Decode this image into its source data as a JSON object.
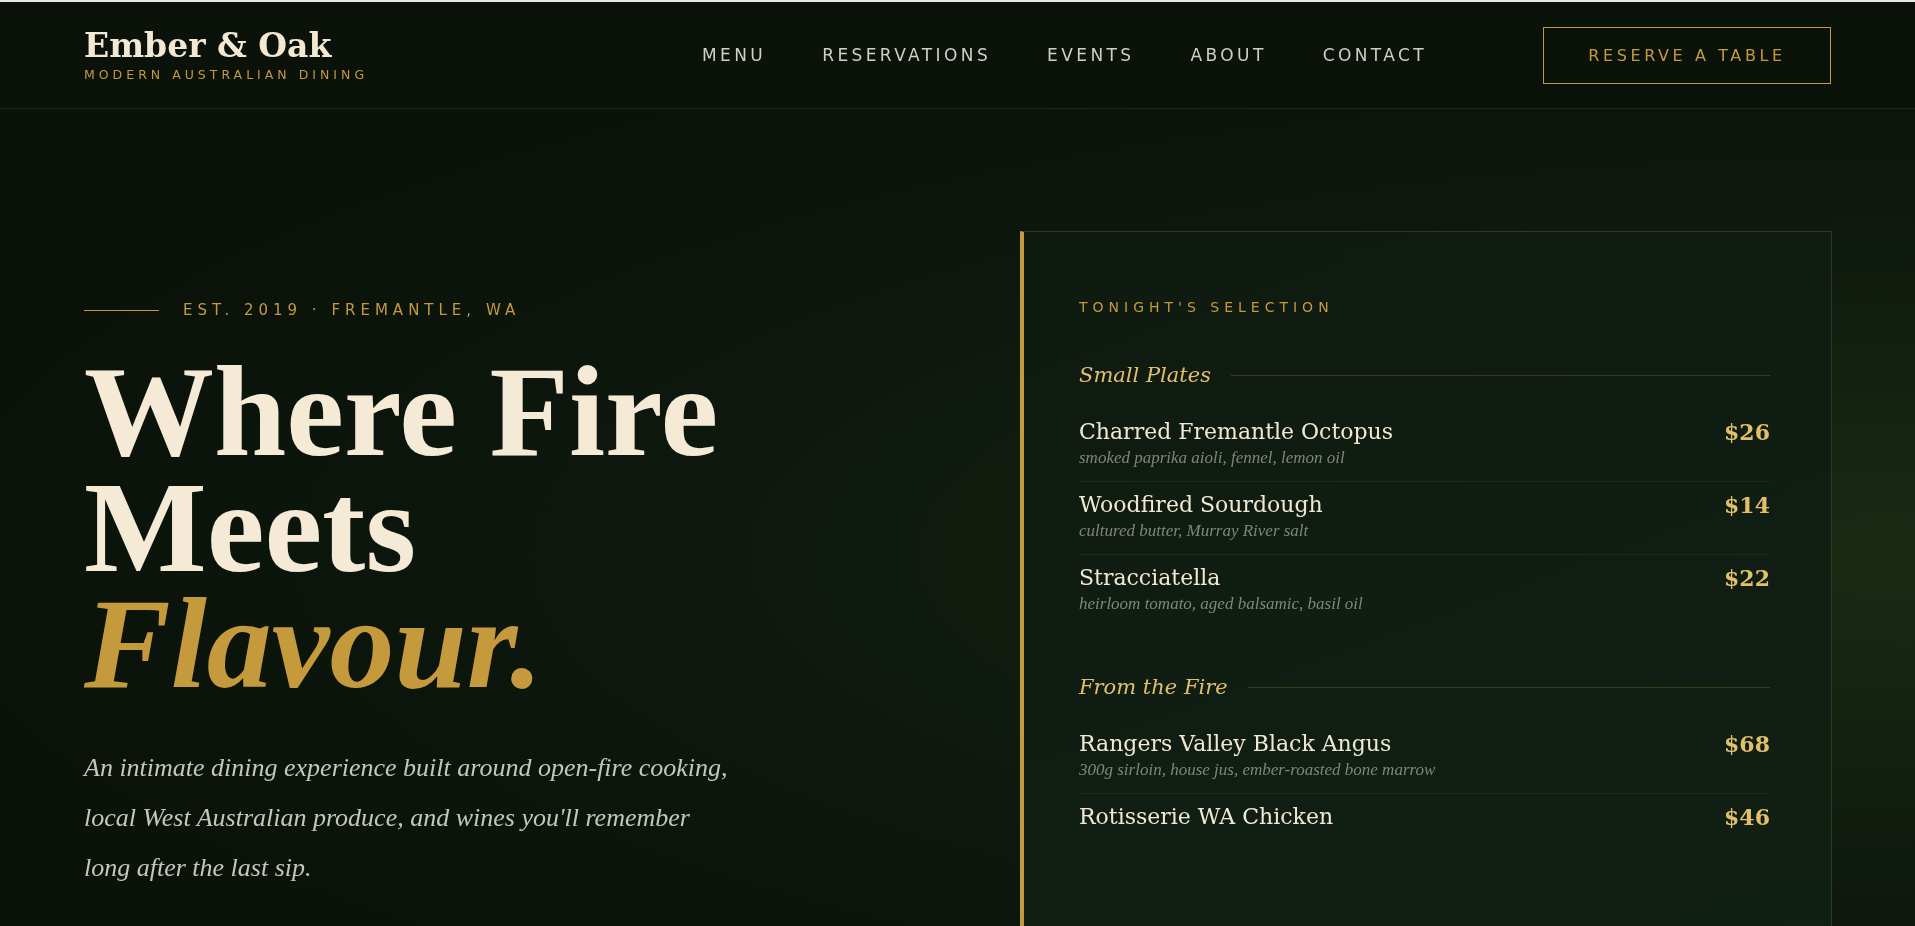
{
  "brand": {
    "name": "Ember & Oak",
    "tagline": "MODERN AUSTRALIAN DINING"
  },
  "nav": [
    {
      "label": "MENU"
    },
    {
      "label": "RESERVATIONS"
    },
    {
      "label": "EVENTS"
    },
    {
      "label": "ABOUT"
    },
    {
      "label": "CONTACT"
    }
  ],
  "cta_button": "RESERVE A TABLE",
  "hero": {
    "eyebrow": "EST. 2019 · FREMANTLE, WA",
    "headline_lines": [
      "Where Fire",
      "Meets"
    ],
    "headline_accent": "Flavour.",
    "intro": "An intimate dining experience built around open-fire cooking, local West Australian produce, and wines you'll remember long after the last sip."
  },
  "menu_card": {
    "title": "TONIGHT'S SELECTION",
    "sections": [
      {
        "name": "Small Plates",
        "items": [
          {
            "name": "Charred Fremantle Octopus",
            "description": "smoked paprika aioli, fennel, lemon oil",
            "price": "$26"
          },
          {
            "name": "Woodfired Sourdough",
            "description": "cultured butter, Murray River salt",
            "price": "$14"
          },
          {
            "name": "Stracciatella",
            "description": "heirloom tomato, aged balsamic, basil oil",
            "price": "$22"
          }
        ]
      },
      {
        "name": "From the Fire",
        "items": [
          {
            "name": "Rangers Valley Black Angus",
            "description": "300g sirloin, house jus, ember-roasted bone marrow",
            "price": "$68"
          },
          {
            "name": "Rotisserie WA Chicken",
            "price": "$46"
          }
        ]
      }
    ]
  }
}
